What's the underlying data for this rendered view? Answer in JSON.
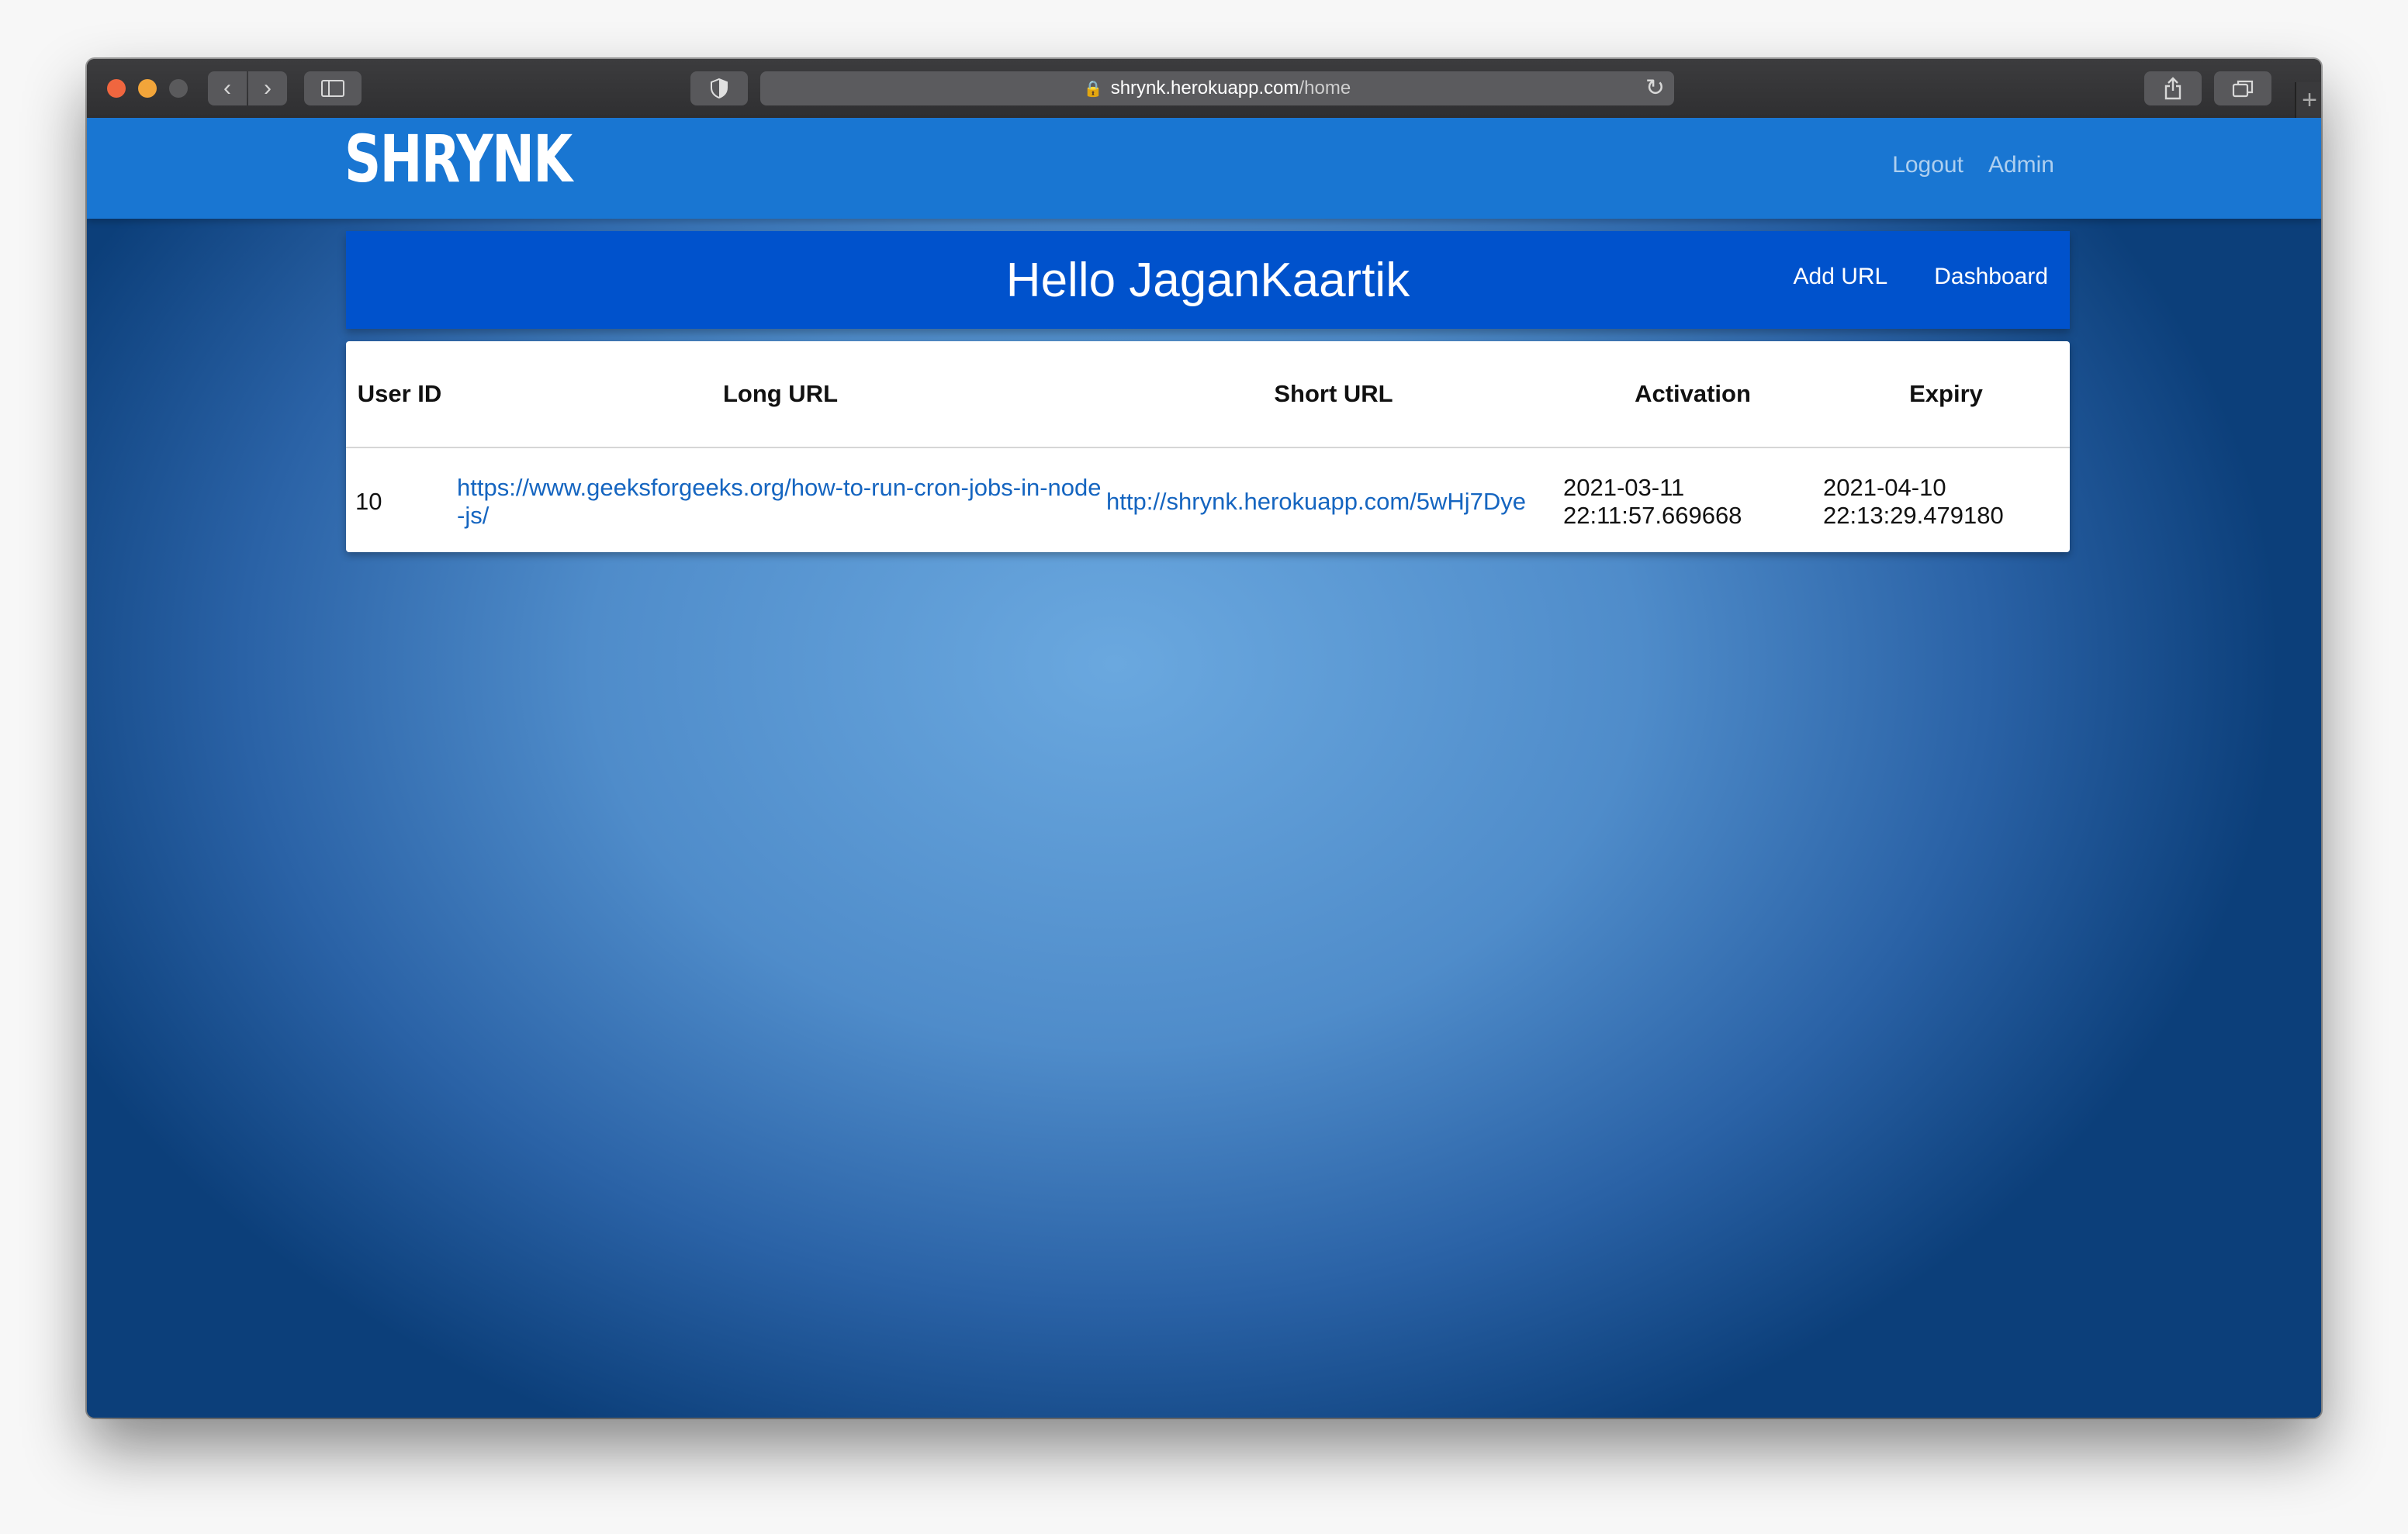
{
  "browser": {
    "url_host": "shrynk.herokuapp.com",
    "url_path": "/home"
  },
  "navbar": {
    "brand": "SHRYNK",
    "links": [
      "Logout",
      "Admin"
    ]
  },
  "hello": {
    "title": "Hello JaganKaartik",
    "add_url": "Add URL",
    "dashboard": "Dashboard"
  },
  "table": {
    "headers": [
      "User ID",
      "Long URL",
      "Short URL",
      "Activation",
      "Expiry"
    ],
    "rows": [
      {
        "user_id": "10",
        "long_url": "https://www.geeksforgeeks.org/how-to-run-cron-jobs-in-node-js/",
        "short_url": "http://shrynk.herokuapp.com/5wHj7Dye",
        "activation": "2021-03-11 22:11:57.669668",
        "expiry": "2021-04-10 22:13:29.479180"
      }
    ]
  },
  "colors": {
    "navbar": "#1976d2",
    "hello_bar": "#0052cc",
    "link": "#1565c0"
  }
}
